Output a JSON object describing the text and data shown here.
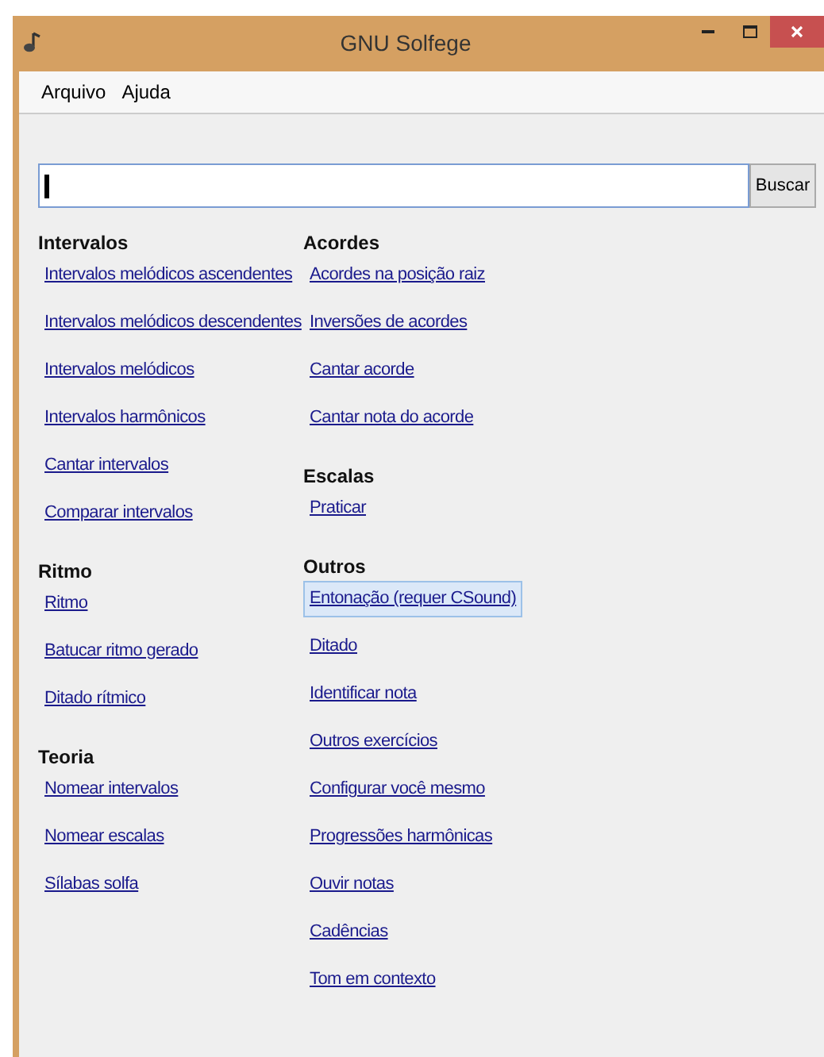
{
  "window": {
    "title": "GNU Solfege"
  },
  "menu": [
    {
      "label": "Arquivo"
    },
    {
      "label": "Ajuda"
    }
  ],
  "search": {
    "button": "Buscar",
    "focused": true
  },
  "columns": [
    {
      "sections": [
        {
          "heading": "Intervalos",
          "items": [
            {
              "label": "Intervalos melódicos ascendentes",
              "selected": false
            },
            {
              "label": "Intervalos melódicos descendentes",
              "selected": false
            },
            {
              "label": "Intervalos melódicos",
              "selected": false
            },
            {
              "label": "Intervalos harmônicos",
              "selected": false
            },
            {
              "label": "Cantar intervalos",
              "selected": false
            },
            {
              "label": "Comparar intervalos",
              "selected": false
            }
          ]
        },
        {
          "heading": "Ritmo",
          "items": [
            {
              "label": "Ritmo",
              "selected": false
            },
            {
              "label": "Batucar ritmo gerado",
              "selected": false
            },
            {
              "label": "Ditado rítmico",
              "selected": false
            }
          ]
        },
        {
          "heading": "Teoria",
          "items": [
            {
              "label": "Nomear intervalos",
              "selected": false
            },
            {
              "label": "Nomear escalas",
              "selected": false
            },
            {
              "label": "Sílabas solfa",
              "selected": false
            }
          ]
        }
      ]
    },
    {
      "sections": [
        {
          "heading": "Acordes",
          "items": [
            {
              "label": "Acordes na posição raiz",
              "selected": false
            },
            {
              "label": "Inversões de acordes",
              "selected": false
            },
            {
              "label": "Cantar acorde",
              "selected": false
            },
            {
              "label": "Cantar nota do acorde",
              "selected": false
            }
          ]
        },
        {
          "heading": "Escalas",
          "items": [
            {
              "label": "Praticar",
              "selected": false
            }
          ]
        },
        {
          "heading": "Outros",
          "items": [
            {
              "label": "Entonação (requer CSound)",
              "selected": true
            },
            {
              "label": "Ditado",
              "selected": false
            },
            {
              "label": "Identificar nota",
              "selected": false
            },
            {
              "label": "Outros exercícios",
              "selected": false
            },
            {
              "label": "Configurar você mesmo",
              "selected": false
            },
            {
              "label": "Progressões harmônicas",
              "selected": false
            },
            {
              "label": "Ouvir notas",
              "selected": false
            },
            {
              "label": "Cadências",
              "selected": false
            },
            {
              "label": "Tom em contexto",
              "selected": false
            }
          ]
        }
      ]
    }
  ]
}
